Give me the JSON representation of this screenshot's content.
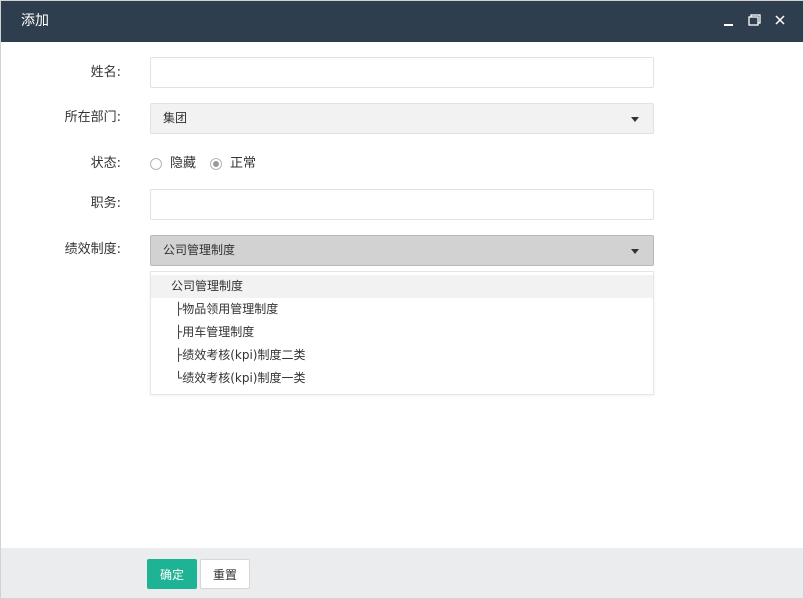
{
  "window": {
    "title": "添加"
  },
  "form": {
    "name_label": "姓名:",
    "name_value": "",
    "dept_label": "所在部门:",
    "dept_value": "集团",
    "status_label": "状态:",
    "status_options": [
      {
        "label": "隐藏",
        "checked": false
      },
      {
        "label": "正常",
        "checked": true
      }
    ],
    "position_label": "职务:",
    "position_value": "",
    "perf_label": "绩效制度:",
    "perf_value": "公司管理制度",
    "perf_options": [
      "公司管理制度",
      "├物品领用管理制度",
      "├用车管理制度",
      "├绩效考核(kpi)制度二类",
      "└绩效考核(kpi)制度一类"
    ]
  },
  "footer": {
    "confirm_label": "确定",
    "reset_label": "重置"
  },
  "colors": {
    "titlebar": "#2f3e4e",
    "primary": "#1fb395",
    "footer_bg": "#eaeced"
  }
}
